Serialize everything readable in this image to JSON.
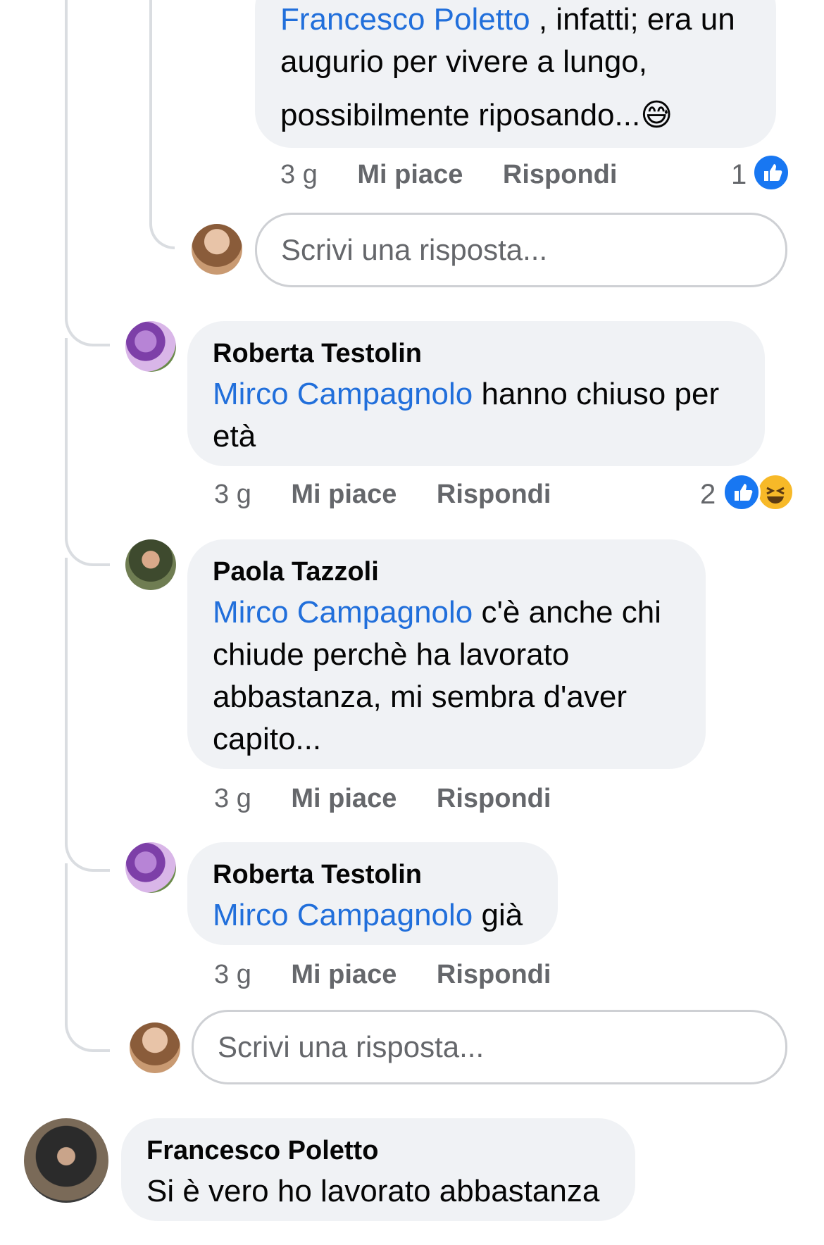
{
  "comments": [
    {
      "mention": "Francesco Poletto",
      "text_line1": " , infatti; era un",
      "text_line2": "augurio per vivere a lungo,",
      "text_line3": "possibilmente riposando...",
      "emoji": "😅",
      "time": "3 g",
      "like_label": "Mi piace",
      "reply_label": "Rispondi",
      "reaction_count": "1"
    },
    {
      "author": "Roberta Testolin",
      "mention": "Mirco Campagnolo",
      "text_line1": " hanno chiuso per",
      "text_line2": "età",
      "time": "3 g",
      "like_label": "Mi piace",
      "reply_label": "Rispondi",
      "reaction_count": "2"
    },
    {
      "author": "Paola Tazzoli",
      "mention": "Mirco Campagnolo",
      "text_line1": " c'è anche chi",
      "text_line2": "chiude perchè ha lavorato",
      "text_line3": "abbastanza, mi sembra d'aver",
      "text_line4": "capito...",
      "time": "3 g",
      "like_label": "Mi piace",
      "reply_label": "Rispondi"
    },
    {
      "author": "Roberta Testolin",
      "mention": "Mirco Campagnolo",
      "text_line1": " già",
      "time": "3 g",
      "like_label": "Mi piace",
      "reply_label": "Rispondi"
    },
    {
      "author": "Francesco Poletto",
      "text_line1": "Si è vero ho lavorato abbastanza"
    }
  ],
  "reply_inputs": [
    {
      "placeholder": "Scrivi una risposta..."
    },
    {
      "placeholder": "Scrivi una risposta..."
    }
  ],
  "colors": {
    "mention": "#216fdb",
    "bubble": "#f0f2f5",
    "meta": "#65676b",
    "like_blue": "#1877f2",
    "haha_yellow": "#f7b928"
  },
  "icons": [
    "like-reaction-icon",
    "haha-reaction-icon",
    "sweat-smile-emoji"
  ]
}
